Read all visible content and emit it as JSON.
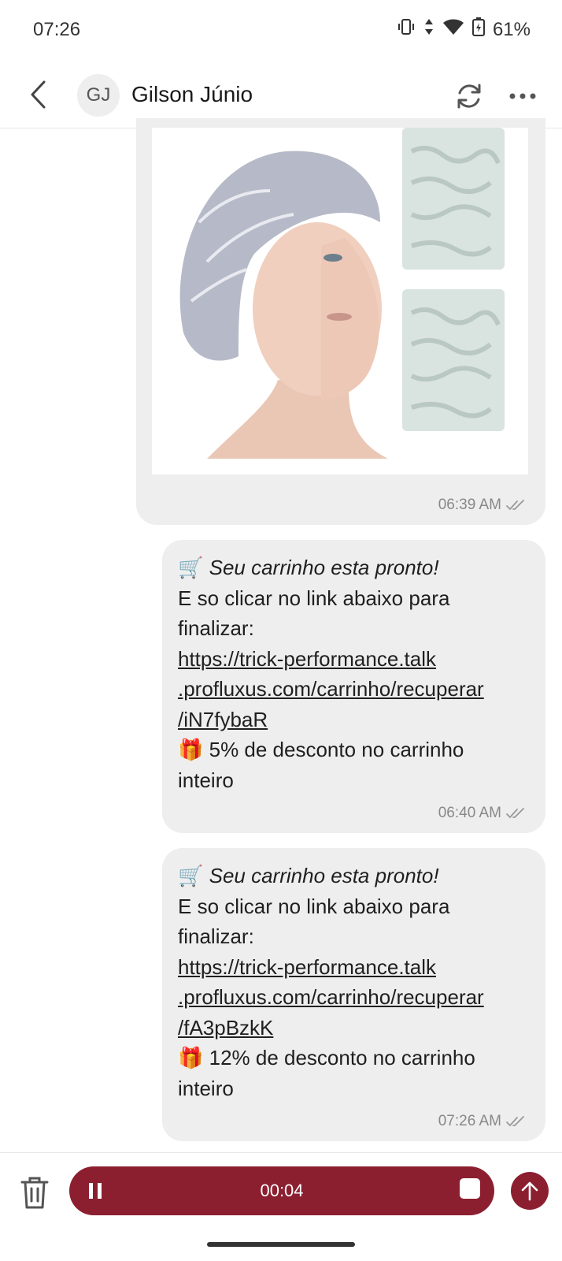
{
  "status_bar": {
    "time": "07:26",
    "battery": "61%",
    "icons": [
      "vibrate-icon",
      "data-arrows-icon",
      "wifi-icon",
      "battery-icon"
    ]
  },
  "header": {
    "avatar_initials": "GJ",
    "contact_name": "Gilson Júnio",
    "icons": [
      "back-arrow-icon",
      "refresh-icon",
      "more-icon"
    ]
  },
  "messages": [
    {
      "type": "image",
      "image_description": "product photo: disposable hair net on woman's head, two packs",
      "time": "06:39 AM",
      "status_icon": "double-check-icon"
    },
    {
      "type": "text",
      "title": "Seu carrinho esta pronto!",
      "line1": "E so clicar no link abaixo para",
      "line2": "finalizar:",
      "link_line1": "https://trick-performance.talk",
      "link_line2": ".profluxus.com/carrinho/recuperar",
      "link_line3": "/iN7fybaR",
      "discount_line1": "5% de desconto no carrinho",
      "discount_line2": "inteiro",
      "time": "06:40 AM"
    },
    {
      "type": "text",
      "title": "Seu carrinho esta pronto!",
      "line1": "E so clicar no link abaixo para",
      "line2": "finalizar:",
      "link_line1": "https://trick-performance.talk",
      "link_line2": ".profluxus.com/carrinho/recuperar",
      "link_line3": "/fA3pBzkK",
      "discount_line1": "12% de desconto no carrinho",
      "discount_line2": "inteiro",
      "time": "07:26 AM"
    }
  ],
  "emoji": {
    "cart": "🛒",
    "gift": "🎁"
  },
  "recorder": {
    "elapsed": "00:04"
  },
  "colors": {
    "accent": "#8b1f30",
    "bubble": "#eeeeee",
    "meta_text": "#888888"
  }
}
